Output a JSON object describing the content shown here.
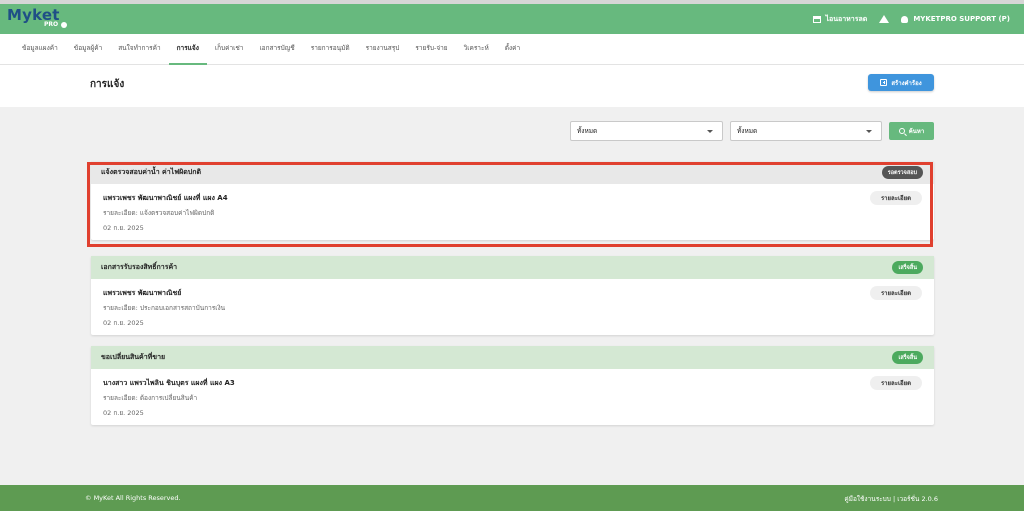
{
  "topbar": {
    "logo_text": "Myket",
    "logo_sub": "PRO",
    "shop_label": "ไอนอาหารลด",
    "user_label": "MYKETPRO SUPPORT (P)",
    "icons": [
      "store-icon",
      "home-icon",
      "user-icon"
    ]
  },
  "nav": {
    "items": [
      "ข้อมูลแผงค้า",
      "ข้อมูลผู้ค้า",
      "สนใจทำการค้า",
      "การแจ้ง",
      "เก็บค่าเช่า",
      "เอกสารบัญชี",
      "รายการอนุมัติ",
      "รายงานสรุป",
      "รายรับ-จ่าย",
      "วิเคราะห์",
      "ตั้งค่า"
    ],
    "active_index": 3
  },
  "header": {
    "title": "การแจ้ง",
    "create_button": "สร้างคำร้อง"
  },
  "filters": {
    "status_value": "ทั้งหมด",
    "type_value": "ทั้งหมด",
    "search_button": "ค้นหา"
  },
  "cards": [
    {
      "title": "แจ้งตรวจสอบค่าน้ำ ค่าไฟผิดปกติ",
      "status": "รอตรวจสอบ",
      "status_type": "pending",
      "name": "แพรวเพชร พัฒนาพาณิชย์ แผงที่ แผง A4",
      "detail": "รายละเอียด: แจ้งตรวจสอบค่าไฟผิดปกติ",
      "date": "02 ก.ย. 2025",
      "detail_button": "รายละเอียด"
    },
    {
      "title": "เอกสารรับรองสิทธิ์การค้า",
      "status": "เสร็จสิ้น",
      "status_type": "done",
      "name": "แพรวเพชร พัฒนาพาณิชย์",
      "detail": "รายละเอียด: ประกอบเอกสารสถาบันการเงิน",
      "date": "02 ก.ย. 2025",
      "detail_button": "รายละเอียด"
    },
    {
      "title": "ขอเปลี่ยนสินค้าที่ขาย",
      "status": "เสร็จสิ้น",
      "status_type": "done",
      "name": "นางสาว แพรวไพลิน ชินบุตร แผงที่ แผง A3",
      "detail": "รายละเอียด: ต้องการเปลี่ยนสินค้า",
      "date": "02 ก.ย. 2025",
      "detail_button": "รายละเอียด"
    }
  ],
  "footer": {
    "copyright": "© MyKet All Rights Reserved.",
    "version": "คู่มือใช้งานระบบ | เวอร์ชั่น 2.0.6"
  },
  "colors": {
    "primary_green": "#67b97e",
    "footer_green": "#5e9b52",
    "button_blue": "#3f95dd",
    "highlight_red": "#e0402f",
    "logo_blue": "#1f4f86"
  }
}
